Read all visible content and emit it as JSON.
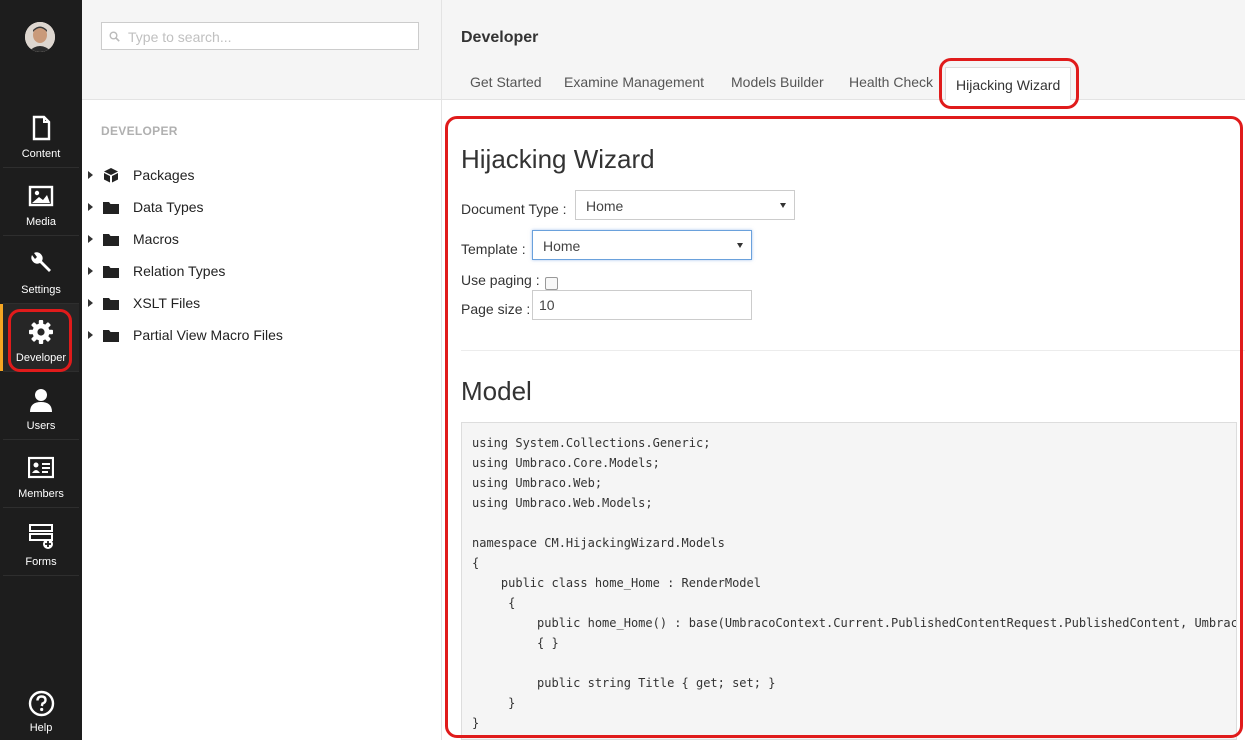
{
  "appbar": {
    "items": [
      {
        "label": "Content",
        "icon": "document-icon"
      },
      {
        "label": "Media",
        "icon": "image-icon"
      },
      {
        "label": "Settings",
        "icon": "wrench-icon"
      },
      {
        "label": "Developer",
        "icon": "gear-icon"
      },
      {
        "label": "Users",
        "icon": "user-icon"
      },
      {
        "label": "Members",
        "icon": "id-card-icon"
      },
      {
        "label": "Forms",
        "icon": "forms-icon"
      }
    ],
    "help_label": "Help",
    "active_accent": "#f5a623"
  },
  "tree": {
    "search_placeholder": "Type to search...",
    "section_title": "DEVELOPER",
    "items": [
      {
        "label": "Packages",
        "icon": "package-icon"
      },
      {
        "label": "Data Types",
        "icon": "folder-icon"
      },
      {
        "label": "Macros",
        "icon": "folder-icon"
      },
      {
        "label": "Relation Types",
        "icon": "folder-icon"
      },
      {
        "label": "XSLT Files",
        "icon": "folder-icon"
      },
      {
        "label": "Partial View Macro Files",
        "icon": "folder-icon"
      }
    ]
  },
  "main": {
    "title": "Developer",
    "tabs": [
      "Get Started",
      "Examine Management",
      "Models Builder",
      "Health Check",
      "Hijacking Wizard"
    ],
    "active_tab": "Hijacking Wizard",
    "wizard": {
      "heading": "Hijacking Wizard",
      "doc_type_label": "Document Type :",
      "doc_type_value": "Home",
      "template_label": "Template :",
      "template_value": "Home",
      "paging_label": "Use paging :",
      "paging_checked": false,
      "page_size_label": "Page size :",
      "page_size_value": "10"
    },
    "model": {
      "heading": "Model",
      "code": "using System.Collections.Generic;\nusing Umbraco.Core.Models;\nusing Umbraco.Web;\nusing Umbraco.Web.Models;\n\nnamespace CM.HijackingWizard.Models\n{\n    public class home_Home : RenderModel\n     {\n         public home_Home() : base(UmbracoContext.Current.PublishedContentRequest.PublishedContent, UmbracoContext.Current.PublishedContentRequest.Culture)\n         { }\n\n         public string Title { get; set; }\n     }\n}"
    }
  },
  "highlight_color": "#e01b1b"
}
